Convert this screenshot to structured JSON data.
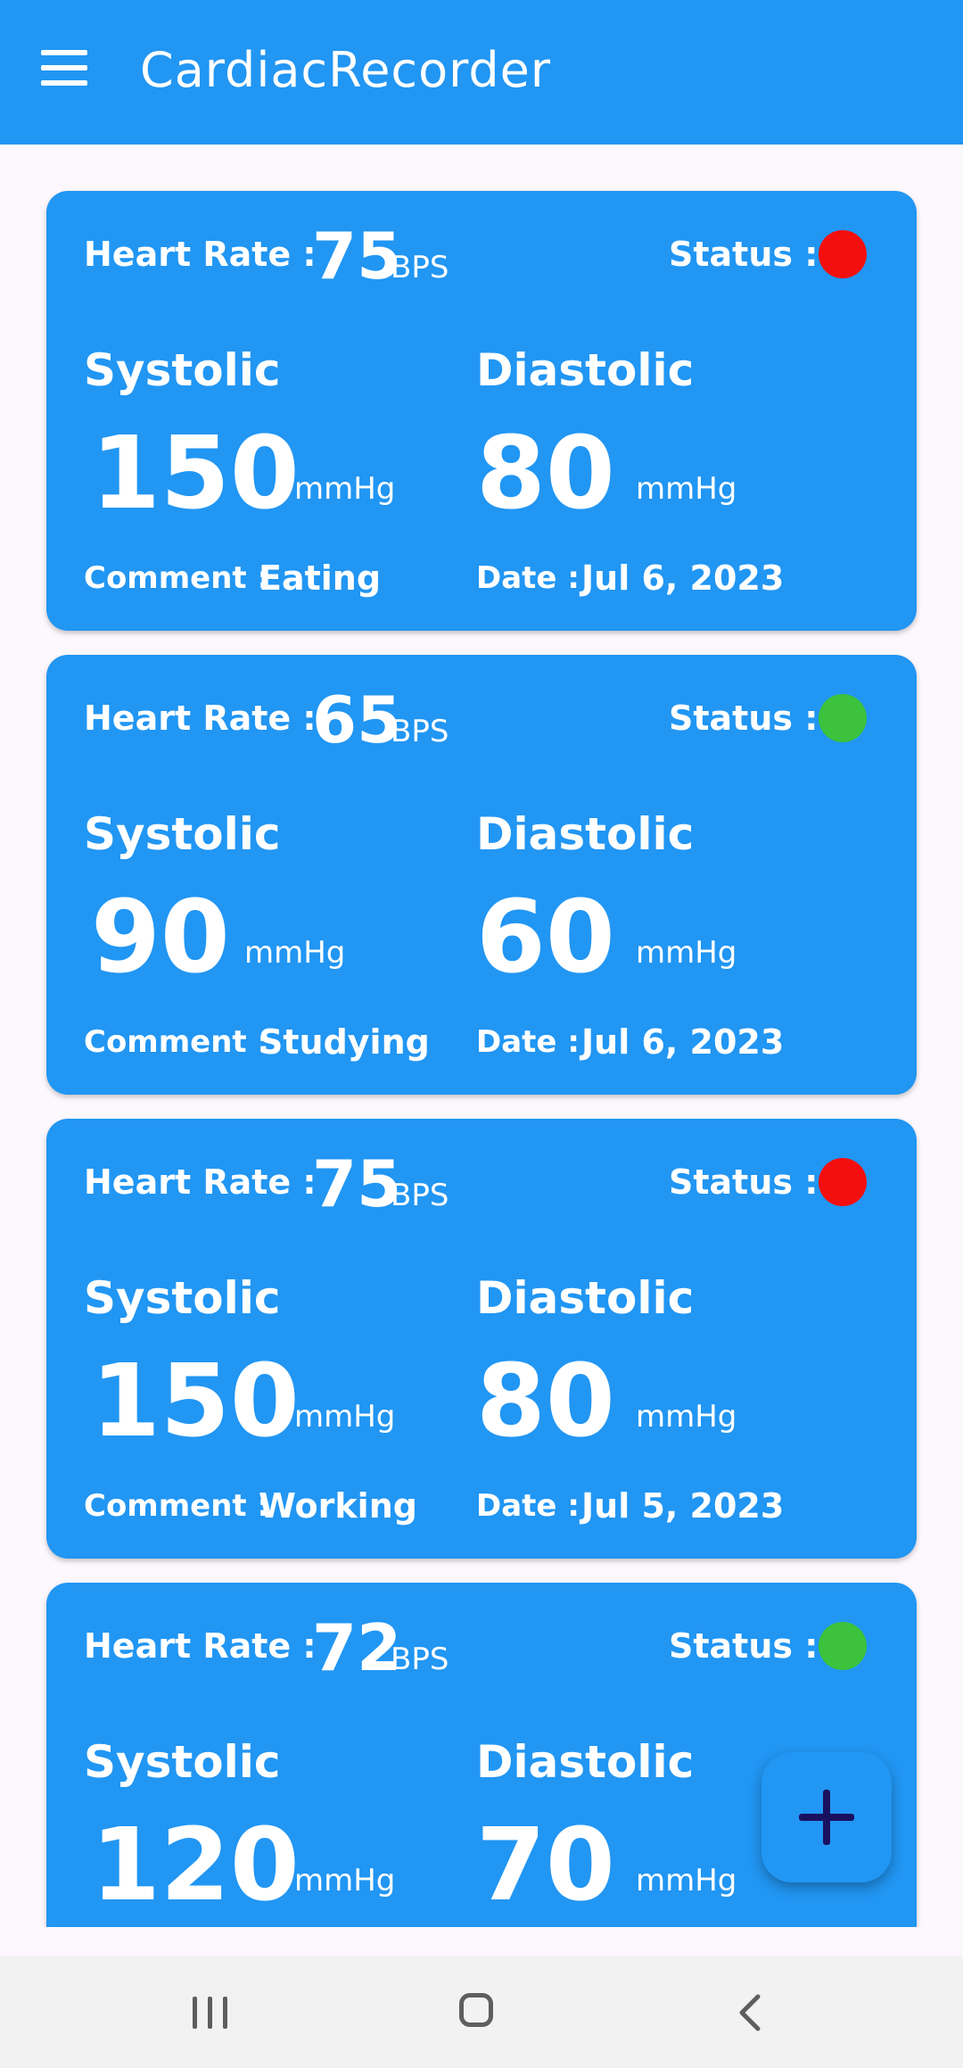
{
  "app_bar": {
    "title": "CardiacRecorder",
    "menu_icon": "hamburger-menu-icon",
    "color": "#2196F3"
  },
  "labels": {
    "heart_rate": "Heart Rate :",
    "bps": "BPS",
    "status": "Status :",
    "systolic": "Systolic",
    "diastolic": "Diastolic",
    "mmhg": "mmHg",
    "comment": "Comment :",
    "date": "Date :"
  },
  "status_colors": {
    "abnormal": "#F40F0F",
    "normal": "#3CC23C"
  },
  "records": [
    {
      "heart_rate": "75",
      "status": "abnormal",
      "systolic": "150",
      "diastolic": "80",
      "comment": "Eating",
      "date": "Jul 6, 2023"
    },
    {
      "heart_rate": "65",
      "status": "normal",
      "systolic": "90",
      "diastolic": "60",
      "comment": "Studying",
      "date": "Jul 6, 2023"
    },
    {
      "heart_rate": "75",
      "status": "abnormal",
      "systolic": "150",
      "diastolic": "80",
      "comment": "Working",
      "date": "Jul 5, 2023"
    },
    {
      "heart_rate": "72",
      "status": "normal",
      "systolic": "120",
      "diastolic": "70"
    }
  ],
  "fab": {
    "icon": "plus-icon"
  },
  "nav_bar": {
    "recents_icon": "recents-icon",
    "home_icon": "home-icon",
    "back_icon": "back-icon"
  }
}
